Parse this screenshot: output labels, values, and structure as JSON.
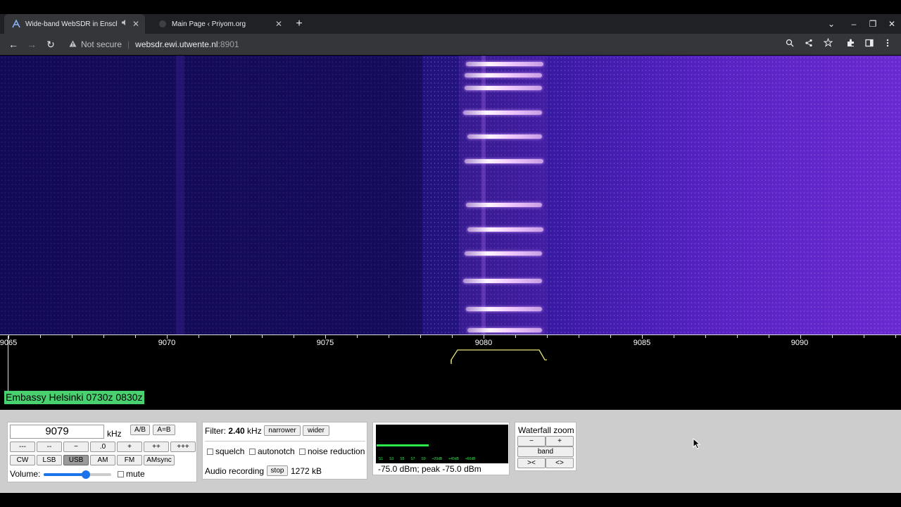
{
  "browser": {
    "tabs": [
      {
        "title": "Wide-band WebSDR in Ensch",
        "active": true,
        "audio": true
      },
      {
        "title": "Main Page ‹ Priyom.org",
        "active": false,
        "audio": false
      }
    ],
    "new_tab": "+",
    "window_controls": {
      "tab_search": "⌄",
      "minimize": "–",
      "restore": "❐",
      "close": "✕"
    },
    "nav": {
      "back": "←",
      "forward": "→",
      "reload": "↻"
    },
    "address": {
      "security_icon": "warning-icon",
      "security_text": "Not secure",
      "separator": "|",
      "host": "websdr.ewi.utwente.nl",
      "port": ":8901"
    }
  },
  "waterfall": {
    "scale_labels": [
      {
        "text": "9065",
        "khz": 9065
      },
      {
        "text": "9070",
        "khz": 9070
      },
      {
        "text": "9075",
        "khz": 9075
      },
      {
        "text": "9080",
        "khz": 9080
      },
      {
        "text": "9085",
        "khz": 9085
      },
      {
        "text": "9090",
        "khz": 9090
      }
    ],
    "station_label": "Embassy Helsinki 0730z 0830z"
  },
  "frequency": {
    "value": "9079",
    "unit": "kHz",
    "ab_button": "A/B",
    "aeqb_button": "A=B",
    "step_buttons": [
      "---",
      "--",
      "−",
      ".0",
      "+",
      "++",
      "+++"
    ],
    "modes": [
      {
        "label": "CW",
        "selected": false
      },
      {
        "label": "LSB",
        "selected": false
      },
      {
        "label": "USB",
        "selected": true
      },
      {
        "label": "AM",
        "selected": false
      },
      {
        "label": "FM",
        "selected": false
      },
      {
        "label": "AMsync",
        "selected": false
      }
    ],
    "volume_label": "Volume:",
    "volume_level": 0.62,
    "mute_label": "mute"
  },
  "filter": {
    "label": "Filter:",
    "width_value": "2.40",
    "width_unit": "kHz",
    "narrower": "narrower",
    "wider": "wider",
    "options": [
      "squelch",
      "autonotch",
      "noise reduction"
    ],
    "recording_label": "Audio recording",
    "stop_button": "stop",
    "recording_size": "1272 kB"
  },
  "smeter": {
    "scale": [
      "S1",
      "S3",
      "S5",
      "S7",
      "S9",
      "+20dB",
      "+40dB",
      "+60dB"
    ],
    "reading": "-75.0 dBm; peak  -75.0 dBm",
    "level": 0.4
  },
  "zoom": {
    "title": "Waterfall zoom",
    "minus": "−",
    "plus": "+",
    "band": "band",
    "shrink": "><",
    "expand": "<>"
  },
  "colors": {
    "station_label_bg": "#49d06f",
    "smeter_green": "#2ee84b",
    "passband_yellow": "#e6e67a",
    "chrome_dark": "#202124"
  }
}
